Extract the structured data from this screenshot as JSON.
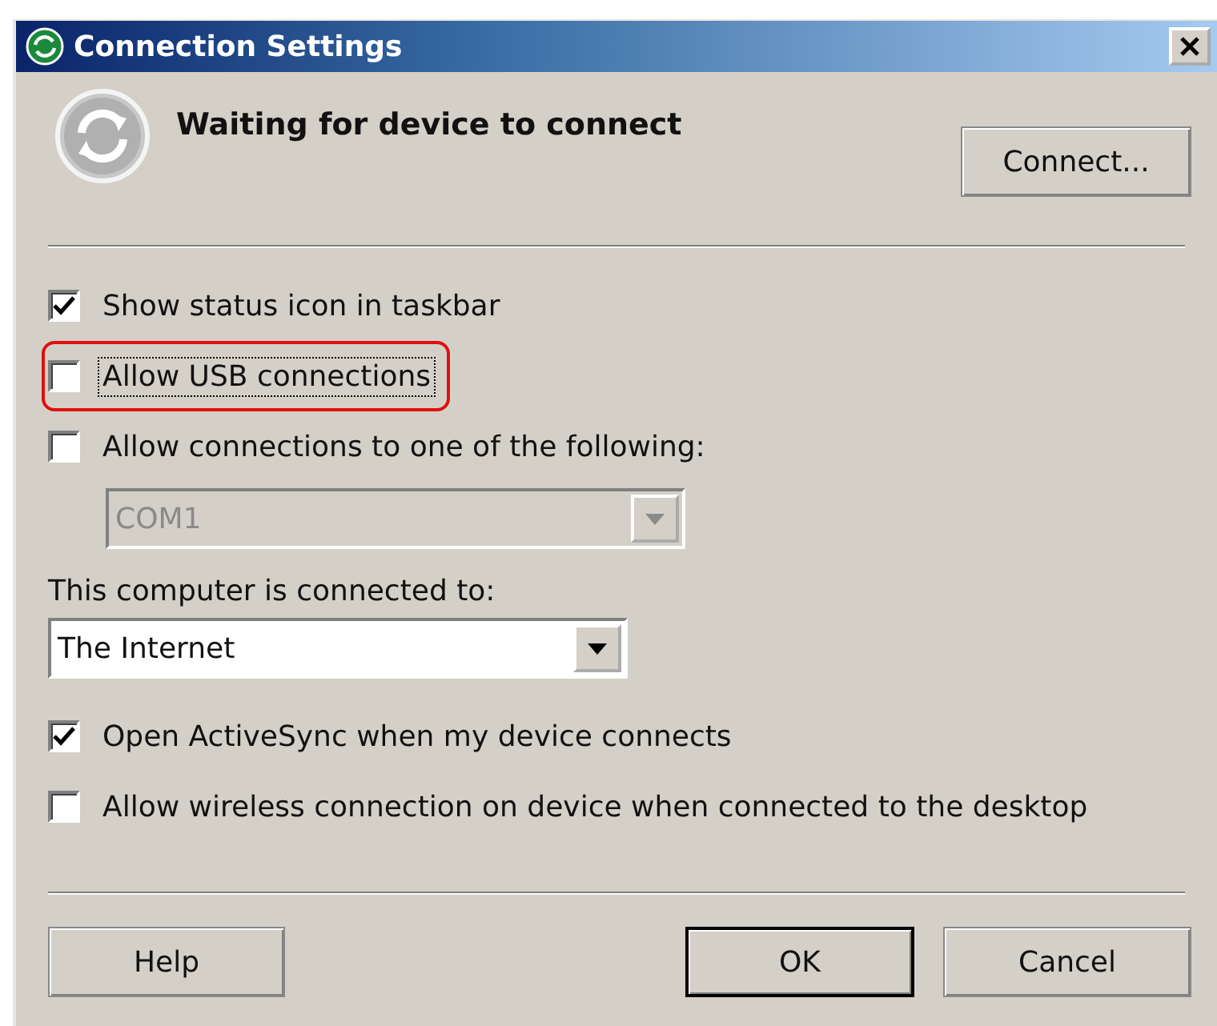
{
  "window": {
    "title": "Connection Settings"
  },
  "header": {
    "status": "Waiting for device to connect",
    "connect_button": "Connect..."
  },
  "options": [
    {
      "kind": "checkbox",
      "label": "Show status icon in taskbar",
      "checked": true,
      "highlighted": false,
      "focused": false
    },
    {
      "kind": "checkbox",
      "label": "Allow USB connections",
      "checked": false,
      "highlighted": true,
      "focused": true
    },
    {
      "kind": "checkbox",
      "label": "Allow connections to one of the following:",
      "checked": false,
      "highlighted": false,
      "focused": false,
      "children": [
        {
          "kind": "dropdown",
          "value": "COM1",
          "disabled": true
        }
      ]
    },
    {
      "kind": "label",
      "label": "This computer is connected to:"
    },
    {
      "kind": "dropdown",
      "value": "The Internet",
      "disabled": false
    },
    {
      "kind": "checkbox",
      "label": "Open ActiveSync when my device connects",
      "checked": true,
      "highlighted": false,
      "focused": false
    },
    {
      "kind": "checkbox",
      "label": "Allow wireless connection on device when connected to the desktop",
      "checked": false,
      "highlighted": false,
      "focused": false
    }
  ],
  "buttons": [
    {
      "label": "Help",
      "default": false
    },
    {
      "label": "OK",
      "default": true
    },
    {
      "label": "Cancel",
      "default": false
    }
  ]
}
